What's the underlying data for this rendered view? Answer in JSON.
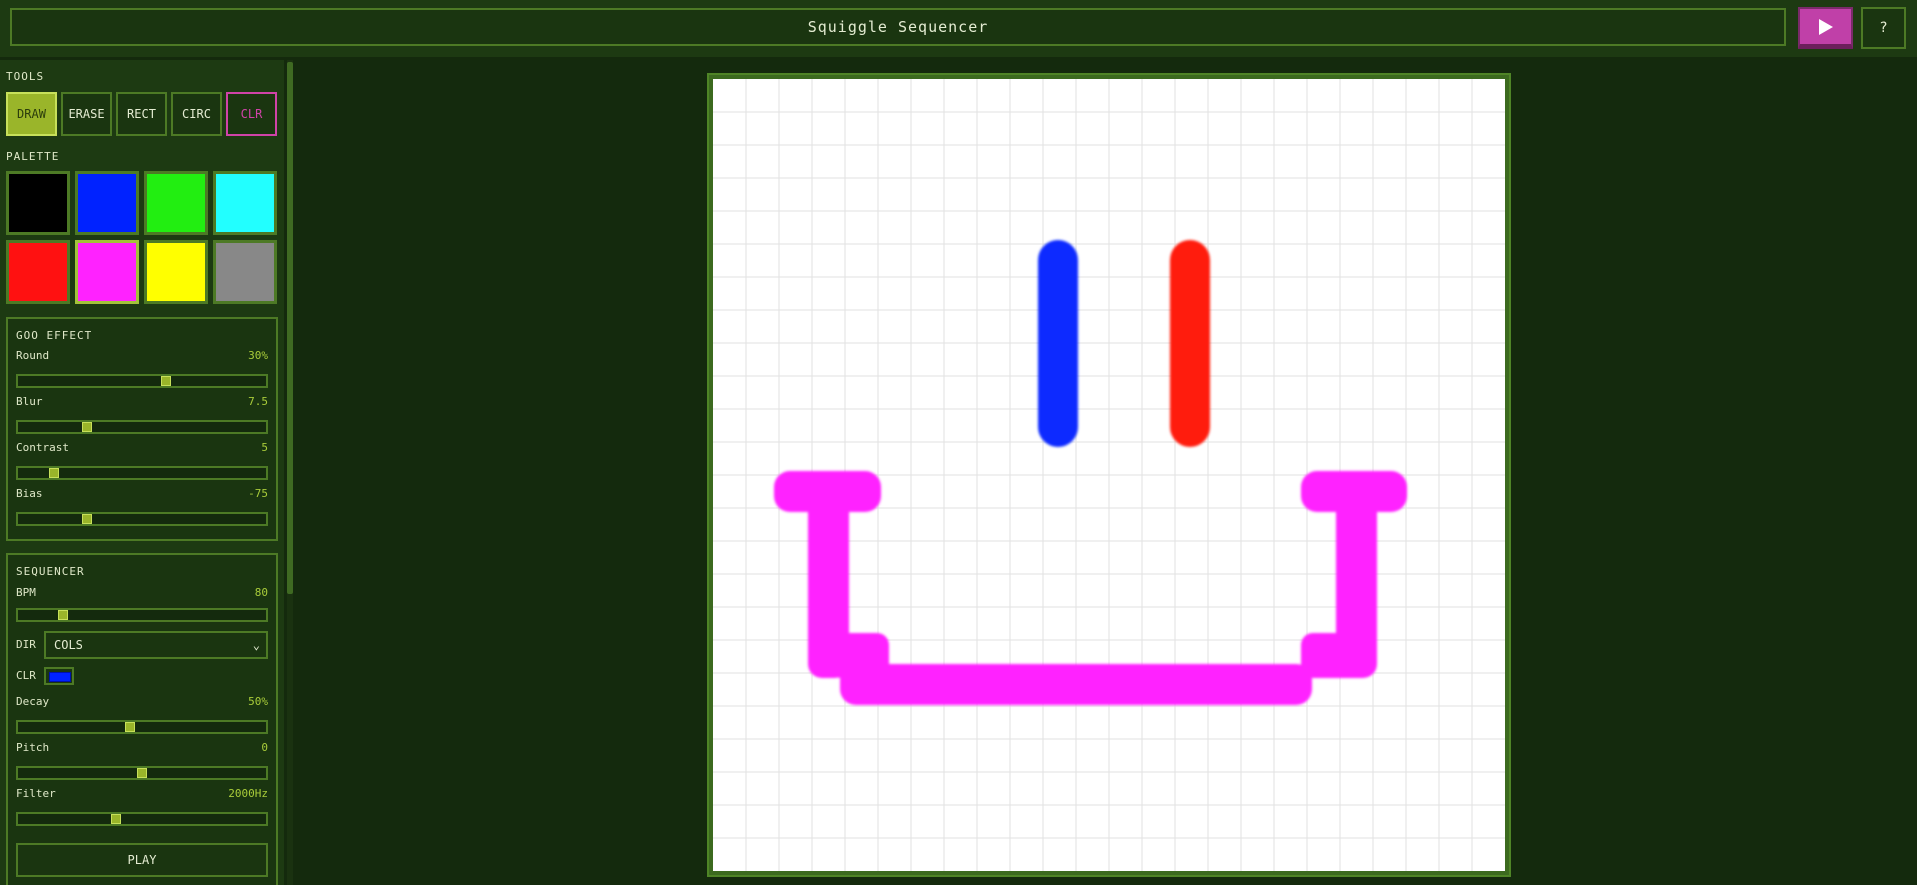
{
  "app": {
    "title": "Squiggle Sequencer",
    "help_label": "?"
  },
  "tools": {
    "section_label": "TOOLS",
    "items": [
      {
        "label": "DRAW",
        "active": true
      },
      {
        "label": "ERASE",
        "active": false
      },
      {
        "label": "RECT",
        "active": false
      },
      {
        "label": "CIRC",
        "active": false
      },
      {
        "label": "CLR",
        "active": false
      }
    ]
  },
  "palette": {
    "section_label": "PALETTE",
    "colors": [
      "#000000",
      "#0022ff",
      "#22ee11",
      "#22ffff",
      "#ff1111",
      "#ff22ff",
      "#ffff00",
      "#888888"
    ],
    "selected": "#ff22ff"
  },
  "goo": {
    "section_label": "GOO EFFECT",
    "round": {
      "label": "Round",
      "value": "30%",
      "level": 0.6
    },
    "blur": {
      "label": "Blur",
      "value": "7.5",
      "level": 0.27
    },
    "contrast": {
      "label": "Contrast",
      "value": "5",
      "level": 0.13
    },
    "bias": {
      "label": "Bias",
      "value": "-75",
      "level": 0.27
    }
  },
  "sequencer": {
    "section_label": "SEQUENCER",
    "bpm": {
      "label": "BPM",
      "value": "80",
      "level": 0.17
    },
    "dir": {
      "label": "DIR",
      "value": "COLS"
    },
    "clr": {
      "label": "CLR",
      "color": "#0022ff"
    },
    "decay": {
      "label": "Decay",
      "value": "50%",
      "level": 0.45
    },
    "pitch": {
      "label": "Pitch",
      "value": "0",
      "level": 0.5
    },
    "filter": {
      "label": "Filter",
      "value": "2000Hz",
      "level": 0.39
    },
    "play_label": "PLAY"
  },
  "canvas": {
    "grid_cells": 24,
    "strokes": [
      {
        "color": "#0a2bff",
        "shape": "eye-left"
      },
      {
        "color": "#ff1a11",
        "shape": "eye-right"
      },
      {
        "color": "#ff22ff",
        "shape": "mouth"
      }
    ]
  }
}
